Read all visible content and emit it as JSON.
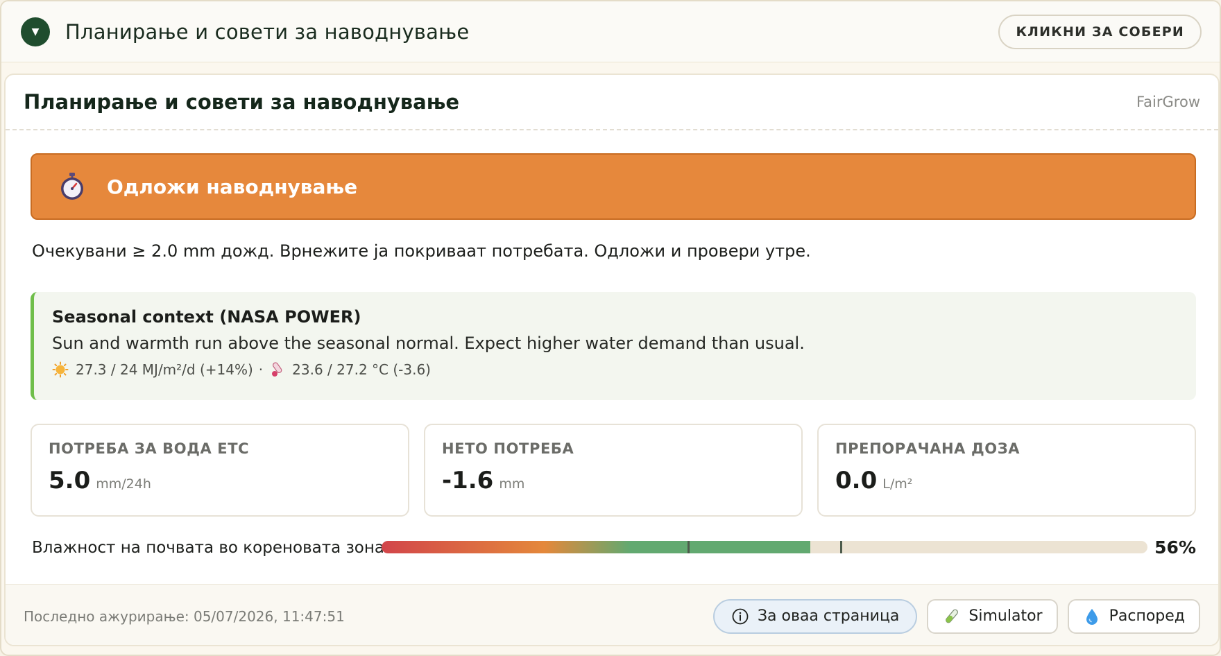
{
  "topbar": {
    "title": "Планирање и совети за наводнување",
    "collapse_label": "КЛИКНИ ЗА СОБЕРИ"
  },
  "card": {
    "title": "Планирање и совети за наводнување",
    "brand": "FairGrow"
  },
  "alert": {
    "text": "Одложи наводнување",
    "icon": "stopwatch-icon",
    "color": "#e6883c"
  },
  "message": "Очекувани ≥ 2.0 mm дожд. Врнежите ја покриваат потребата. Одложи и провери утре.",
  "seasonal": {
    "title": "Seasonal context (NASA POWER)",
    "description": "Sun and warmth run above the seasonal normal. Expect higher water demand than usual.",
    "radiation": "27.3 / 24 MJ/m²/d (+14%)",
    "separator": "·",
    "temperature": "23.6 / 27.2 °C (-3.6)",
    "accent": "#6fbe4a"
  },
  "stats": [
    {
      "label": "ПОТРЕБА ЗА ВОДА ETC",
      "value": "5.0",
      "unit": "mm/24h"
    },
    {
      "label": "НЕТО ПОТРЕБА",
      "value": "-1.6",
      "unit": "mm"
    },
    {
      "label": "ПРЕПОРАЧАНА ДОЗА",
      "value": "0.0",
      "unit": "L/m²"
    }
  ],
  "moisture": {
    "label": "Влажност на почвата во кореновата зона",
    "percent_label": "56%",
    "percent": 56,
    "markers": [
      40,
      60
    ]
  },
  "footer": {
    "updated": "Последно ажурирање: 05/07/2026, 11:47:51",
    "about_label": "За оваа страница",
    "simulator_label": "Simulator",
    "schedule_label": "Распоред"
  }
}
